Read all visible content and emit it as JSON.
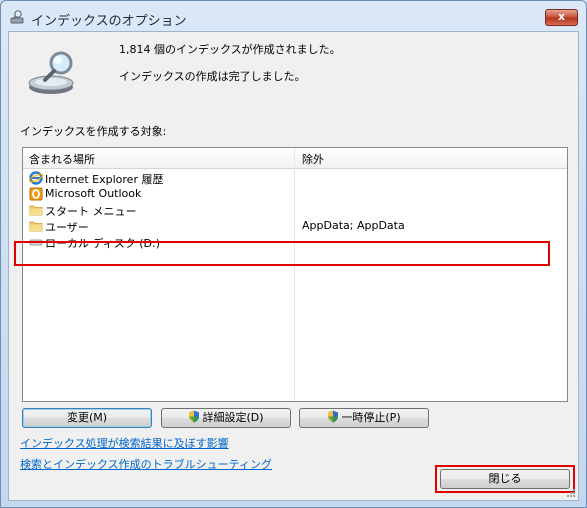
{
  "window": {
    "title": "インデックスのオプション",
    "close_glyph": "x"
  },
  "status": {
    "line1": "1,814 個のインデックスが作成されました。",
    "line2": "インデックスの作成は完了しました。"
  },
  "section_label": "インデックスを作成する対象:",
  "list": {
    "columns": [
      "含まれる場所",
      "除外"
    ],
    "rows": [
      {
        "icon": "internet-explorer-icon",
        "name": "Internet Explorer 履歴",
        "exclude": ""
      },
      {
        "icon": "outlook-icon",
        "name": "Microsoft Outlook",
        "exclude": ""
      },
      {
        "icon": "folder-icon",
        "name": "スタート メニュー",
        "exclude": ""
      },
      {
        "icon": "folder-icon",
        "name": "ユーザー",
        "exclude": "AppData; AppData"
      },
      {
        "icon": "drive-icon",
        "name": "ローカル ディスク (D:)",
        "exclude": ""
      }
    ]
  },
  "buttons": {
    "modify": "変更(M)",
    "advanced": "詳細設定(D)",
    "pause": "一時停止(P)",
    "close": "閉じる"
  },
  "links": {
    "effect": "インデックス処理が検索結果に及ぼす影響",
    "troubleshoot": "検索とインデックス作成のトラブルシューティング"
  },
  "colors": {
    "highlight": "#e00000",
    "link": "#0066cc"
  }
}
